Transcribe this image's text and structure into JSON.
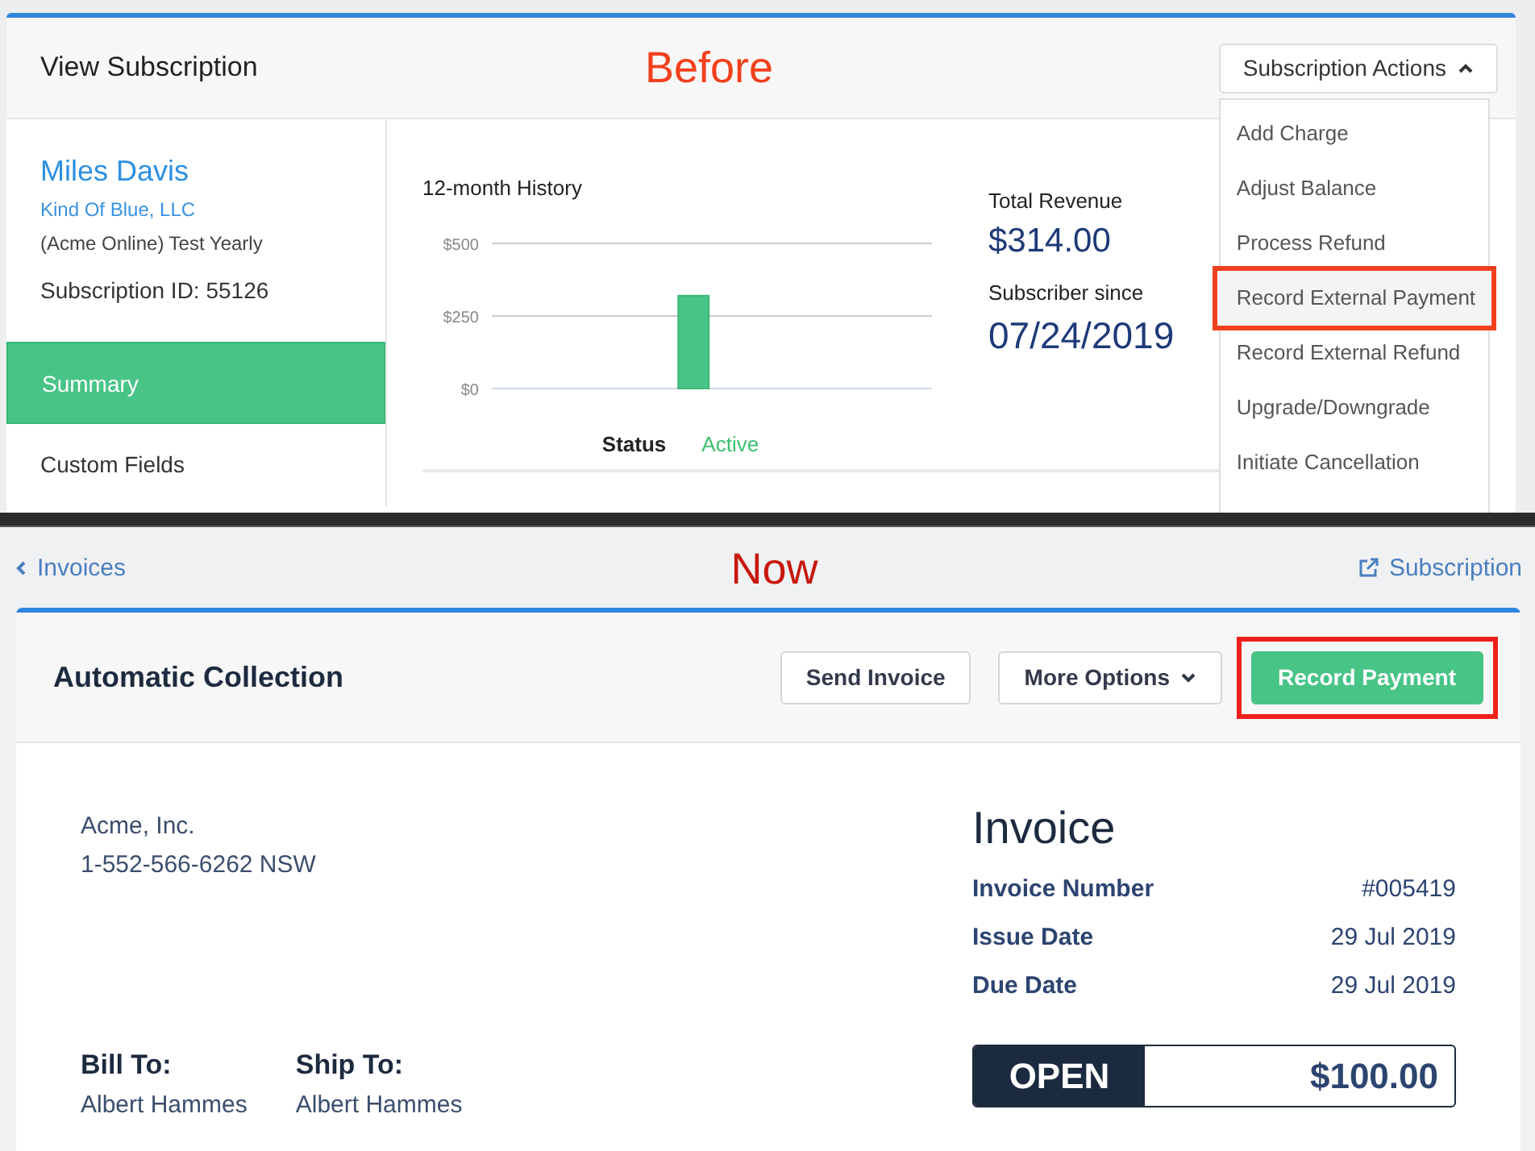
{
  "before": {
    "label": "Before",
    "title": "View Subscription",
    "actions_button": {
      "label": "Subscription Actions",
      "expanded": true
    },
    "actions_menu": [
      {
        "label": "Add Charge",
        "highlighted": false
      },
      {
        "label": "Adjust Balance",
        "highlighted": false
      },
      {
        "label": "Process Refund",
        "highlighted": false
      },
      {
        "label": "Record External Payment",
        "highlighted": true
      },
      {
        "label": "Record External Refund",
        "highlighted": false
      },
      {
        "label": "Upgrade/Downgrade",
        "highlighted": false
      },
      {
        "label": "Initiate Cancellation",
        "highlighted": false
      }
    ],
    "customer": {
      "name": "Miles Davis",
      "company": "Kind Of Blue, LLC",
      "plan": "(Acme Online) Test Yearly",
      "subscription_id": "Subscription ID: 55126"
    },
    "sidebar": {
      "items": [
        {
          "label": "Summary",
          "selected": true
        },
        {
          "label": "Custom Fields",
          "selected": false
        }
      ]
    },
    "history": {
      "chart_data": {
        "type": "bar",
        "title": "12-month History",
        "values": [
          null,
          null,
          null,
          null,
          null,
          320,
          null,
          null,
          null,
          null,
          null,
          null
        ],
        "ylim": [
          0,
          500
        ],
        "yticks": [
          {
            "value": 0,
            "label": "$0"
          },
          {
            "value": 250,
            "label": "$250"
          },
          {
            "value": 500,
            "label": "$500"
          }
        ]
      }
    },
    "status": {
      "label": "Status",
      "value": "Active"
    },
    "stats": [
      {
        "label": "Total Revenue",
        "value": "$314.00"
      },
      {
        "label": "Subscriber since",
        "value": "07/24/2019"
      }
    ]
  },
  "now": {
    "label": "Now",
    "back_link": "Invoices",
    "subscription_link": "Subscription",
    "title": "Automatic Collection",
    "buttons": [
      {
        "label": "Send Invoice",
        "kind": "plain",
        "highlighted": false
      },
      {
        "label": "More Options",
        "kind": "dropdown",
        "highlighted": false
      },
      {
        "label": "Record Payment",
        "kind": "primary",
        "highlighted": true
      }
    ],
    "company": [
      "Acme, Inc.",
      "1-552-566-6262 NSW"
    ],
    "parties": [
      {
        "label": "Bill To:",
        "name": "Albert Hammes"
      },
      {
        "label": "Ship To:",
        "name": "Albert Hammes"
      }
    ],
    "invoice": {
      "title": "Invoice",
      "fields": [
        {
          "label": "Invoice Number",
          "value": "#005419"
        },
        {
          "label": "Issue Date",
          "value": "29 Jul 2019"
        },
        {
          "label": "Due Date",
          "value": "29 Jul 2019"
        }
      ]
    },
    "balance": {
      "status": "OPEN",
      "amount": "$100.00"
    }
  }
}
